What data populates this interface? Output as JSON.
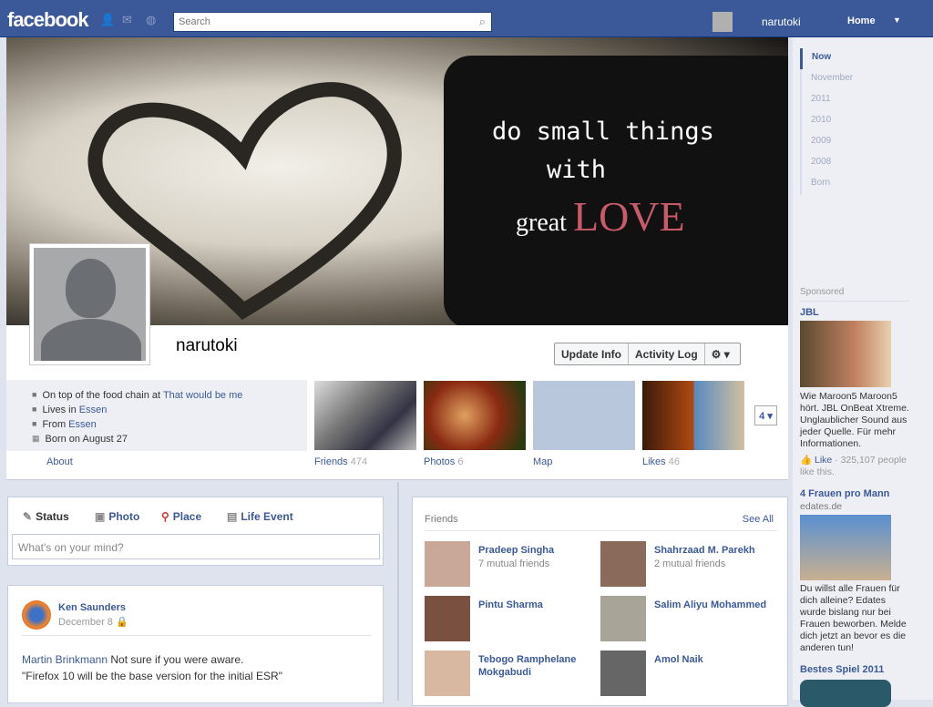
{
  "topbar": {
    "logo": "facebook",
    "search_placeholder": "Search",
    "user": "narutoki",
    "home": "Home"
  },
  "cover": {
    "line1": "do small things",
    "line2": "with",
    "line3_a": "great ",
    "line3_b": "LOVE"
  },
  "profile": {
    "name": "narutoki",
    "buttons": {
      "update_info": "Update Info",
      "activity_log": "Activity Log"
    },
    "info": [
      {
        "text": "On top of the food chain at ",
        "link": "That would be me"
      },
      {
        "text": "Lives in ",
        "link": "Essen"
      },
      {
        "text": "From ",
        "link": "Essen"
      },
      {
        "text": "Born on August 27",
        "link": ""
      }
    ],
    "about": "About",
    "tiles": [
      {
        "label": "Friends",
        "count": "474"
      },
      {
        "label": "Photos",
        "count": "6"
      },
      {
        "label": "Map",
        "count": ""
      },
      {
        "label": "Likes",
        "count": "46"
      }
    ],
    "more": "4"
  },
  "composer": {
    "tabs": [
      "Status",
      "Photo",
      "Place",
      "Life Event"
    ],
    "placeholder": "What's on your mind?"
  },
  "post": {
    "author": "Ken Saunders",
    "date": "December 8",
    "mention": "Martin Brinkmann",
    "text1": " Not sure if you were aware.",
    "text2": "\"Firefox 10 will be the base version for the initial ESR\""
  },
  "friends": {
    "title": "Friends",
    "see_all": "See All",
    "items": [
      {
        "name": "Pradeep Singha",
        "mutual": "7 mutual friends"
      },
      {
        "name": "Shahrzaad M. Parekh",
        "mutual": "2 mutual friends"
      },
      {
        "name": "Pintu Sharma",
        "mutual": ""
      },
      {
        "name": "Salim Aliyu Mohammed",
        "mutual": ""
      },
      {
        "name": "Tebogo Ramphelane Mokgabudi",
        "mutual": ""
      },
      {
        "name": "Amol Naik",
        "mutual": ""
      }
    ]
  },
  "timeline_nav": [
    "Now",
    "November",
    "2011",
    "2010",
    "2009",
    "2008",
    "Born"
  ],
  "ads": {
    "sponsored": "Sponsored",
    "ad1": {
      "title": "JBL",
      "text": "Wie Maroon5 Maroon5 hört. JBL OnBeat Xtreme. Unglaublicher Sound aus jeder Quelle. Für mehr Informationen.",
      "like": "Like",
      "likes": " · 325,107 people like this."
    },
    "ad2": {
      "title": "4 Frauen pro Mann",
      "domain": "edates.de",
      "text": "Du willst alle Frauen für dich alleine? Edates wurde bislang nur bei Frauen beworben. Melde dich jetzt an bevor es die anderen tun!"
    },
    "ad3": {
      "title": "Bestes Spiel 2011"
    }
  }
}
